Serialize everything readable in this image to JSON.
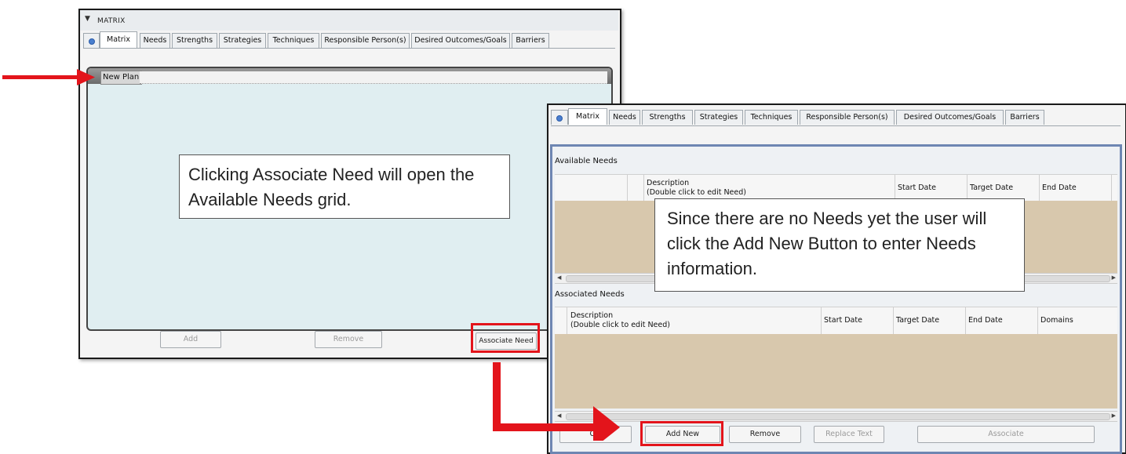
{
  "left_window": {
    "section_title": "MATRIX",
    "tabs": [
      "Matrix",
      "Needs",
      "Strengths",
      "Strategies",
      "Techniques",
      "Responsible Person(s)",
      "Desired Outcomes/Goals",
      "Barriers"
    ],
    "plan_name": "New Plan",
    "buttons": {
      "add": "Add",
      "remove": "Remove",
      "associate_need": "Associate Need"
    }
  },
  "callout_left": "Clicking Associate Need will open the Available Needs grid.",
  "right_window": {
    "tabs": [
      "Matrix",
      "Needs",
      "Strengths",
      "Strategies",
      "Techniques",
      "Responsible Person(s)",
      "Desired Outcomes/Goals",
      "Barriers"
    ],
    "available_needs": {
      "title": "Available Needs",
      "columns": {
        "description": "Description",
        "description_hint": "(Double click to edit Need)",
        "start_date": "Start Date",
        "target_date": "Target Date",
        "end_date": "End Date"
      }
    },
    "associated_needs": {
      "title": "Associated Needs",
      "columns": {
        "description": "Description",
        "description_hint": "(Double click to edit Need)",
        "start_date": "Start Date",
        "target_date": "Target Date",
        "end_date": "End Date",
        "domains": "Domains"
      }
    },
    "buttons": {
      "close": "Clo",
      "add_new": "Add New",
      "remove": "Remove",
      "replace_text": "Replace Text",
      "associate": "Associate"
    }
  },
  "callout_right": "Since there are no Needs yet the user will click the Add New Button to enter Needs information.",
  "colors": {
    "highlight": "#e3141b",
    "grid_empty": "#d8c8ad",
    "panel_bg": "#e0eef1",
    "panel_border_blue": "#6e86b2"
  }
}
